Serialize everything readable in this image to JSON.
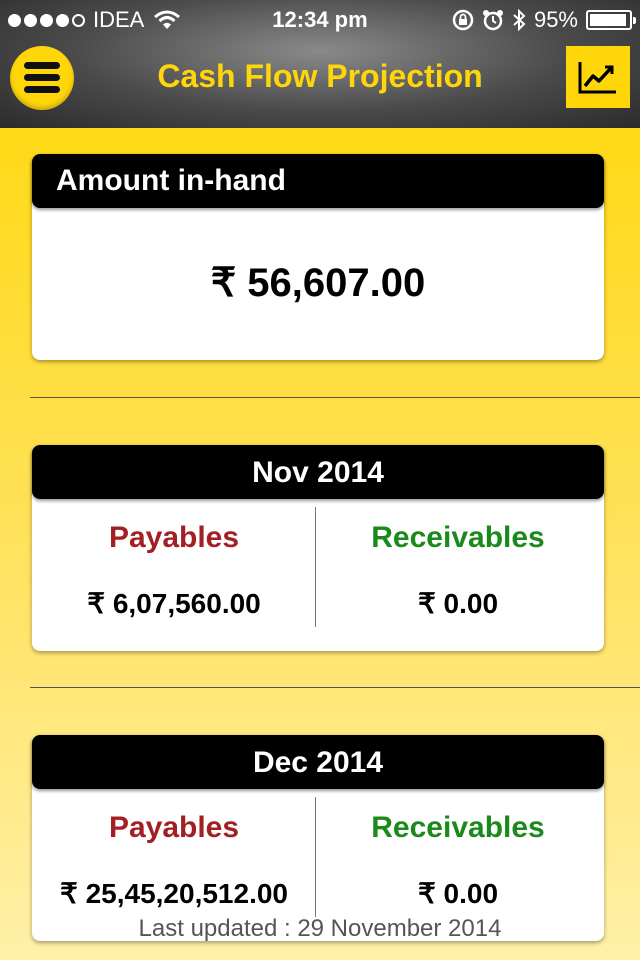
{
  "status_bar": {
    "carrier": "IDEA",
    "signal_bars_filled": 4,
    "signal_bars_total": 5,
    "time": "12:34 pm",
    "battery_percent": "95%",
    "battery_level": 0.95
  },
  "nav": {
    "title": "Cash Flow Projection",
    "menu_icon": "hamburger-menu-icon",
    "chart_icon": "trend-chart-icon",
    "accent_color": "#ffd60a"
  },
  "amount_card": {
    "header": "Amount in-hand",
    "value": "₹ 56,607.00"
  },
  "months": [
    {
      "title": "Nov 2014",
      "payables_label": "Payables",
      "payables_value": "₹ 6,07,560.00",
      "receivables_label": "Receivables",
      "receivables_value": "₹ 0.00"
    },
    {
      "title": "Dec 2014",
      "payables_label": "Payables",
      "payables_value": "₹ 25,45,20,512.00",
      "receivables_label": "Receivables",
      "receivables_value": "₹ 0.00"
    }
  ],
  "footer": {
    "last_updated": "Last updated : 29 November 2014"
  },
  "colors": {
    "payables": "#a31f24",
    "receivables": "#1b8a1b"
  }
}
